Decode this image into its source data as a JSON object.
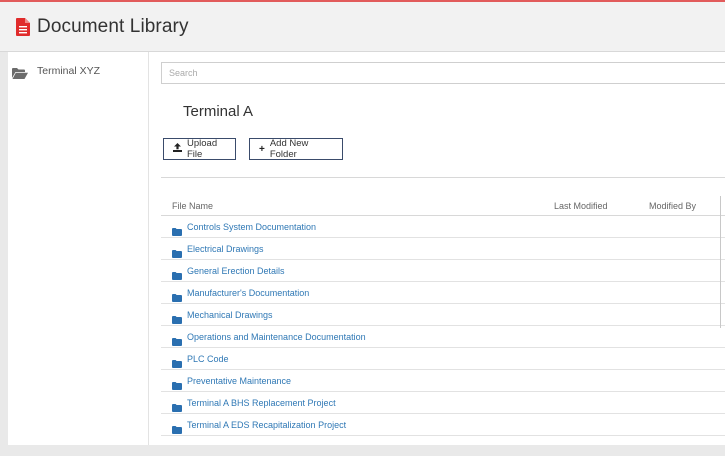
{
  "header": {
    "title": "Document Library",
    "icon": "file-pdf-icon",
    "accent": "#e02b2b"
  },
  "sidebar": {
    "items": [
      {
        "label": "Terminal XYZ",
        "icon": "folder-open-icon"
      }
    ]
  },
  "main": {
    "search_placeholder": "Search",
    "folder_title": "Terminal A",
    "upload_label": "Upload File",
    "add_folder_label": "Add New Folder",
    "columns": {
      "name": "File Name",
      "modified": "Last Modified",
      "modified_by": "Modified By"
    },
    "rows": [
      {
        "name": "Controls System Documentation"
      },
      {
        "name": "Electrical Drawings"
      },
      {
        "name": "General Erection Details"
      },
      {
        "name": "Manufacturer's Documentation"
      },
      {
        "name": "Mechanical Drawings"
      },
      {
        "name": "Operations and Maintenance Documentation"
      },
      {
        "name": "PLC Code"
      },
      {
        "name": "Preventative Maintenance"
      },
      {
        "name": "Terminal A BHS Replacement Project"
      },
      {
        "name": "Terminal A EDS Recapitalization Project"
      }
    ]
  },
  "colors": {
    "link": "#2f78b5",
    "folder": "#2a6fb0",
    "button_border": "#3a4b6b"
  }
}
